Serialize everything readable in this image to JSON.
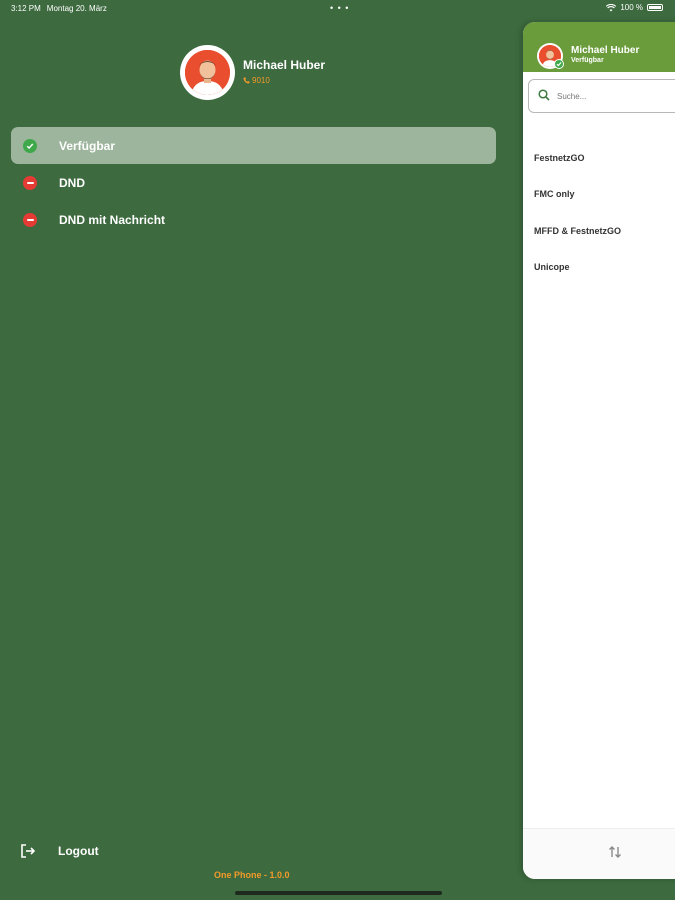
{
  "status_bar": {
    "time": "3:12 PM",
    "date": "Montag 20. März",
    "dots": "• • •",
    "battery_text": "100 %"
  },
  "profile": {
    "name": "Michael Huber",
    "extension": "9010"
  },
  "statuses": [
    {
      "label": "Verfügbar",
      "selected": true,
      "icon": "check-circle-icon"
    },
    {
      "label": "DND",
      "selected": false,
      "icon": "minus-circle-icon"
    },
    {
      "label": "DND mit Nachricht",
      "selected": false,
      "icon": "minus-circle-icon"
    }
  ],
  "logout": {
    "label": "Logout"
  },
  "footer": {
    "version": "One Phone - 1.0.0"
  },
  "panel": {
    "name": "Michael Huber",
    "status": "Verfügbar",
    "search_placeholder": "Suche...",
    "items": [
      {
        "label": "FestnetzGO"
      },
      {
        "label": "FMC only"
      },
      {
        "label": "MFFD & FestnetzGO"
      },
      {
        "label": "Unicope"
      }
    ]
  },
  "colors": {
    "background": "#3d6a3f",
    "selected_row": "#9db59d",
    "panel_header": "#6a9c3c",
    "accent_orange": "#f39a2a",
    "available_green": "#3fa84a",
    "dnd_red": "#e53b35"
  }
}
